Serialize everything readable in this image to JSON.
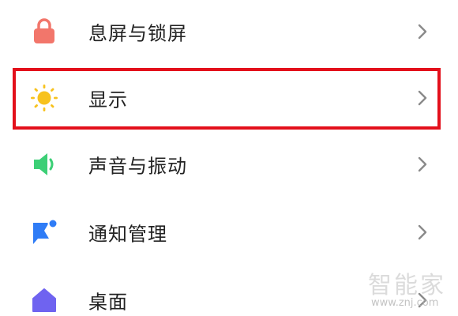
{
  "menu": {
    "items": [
      {
        "label": "息屏与锁屏",
        "icon": "lock-icon",
        "icon_color": "#f2766b"
      },
      {
        "label": "显示",
        "icon": "sun-icon",
        "icon_color": "#f7c21e"
      },
      {
        "label": "声音与振动",
        "icon": "speaker-icon",
        "icon_color": "#3ccf76"
      },
      {
        "label": "通知管理",
        "icon": "notification-flag-icon",
        "icon_color": "#2f7cf6"
      },
      {
        "label": "桌面",
        "icon": "home-icon",
        "icon_color": "#6f63f0"
      }
    ]
  },
  "highlight": {
    "color": "#e3101b",
    "target": "显示"
  },
  "watermark": {
    "logo_text": "智能家",
    "url": "www.znj.com"
  }
}
